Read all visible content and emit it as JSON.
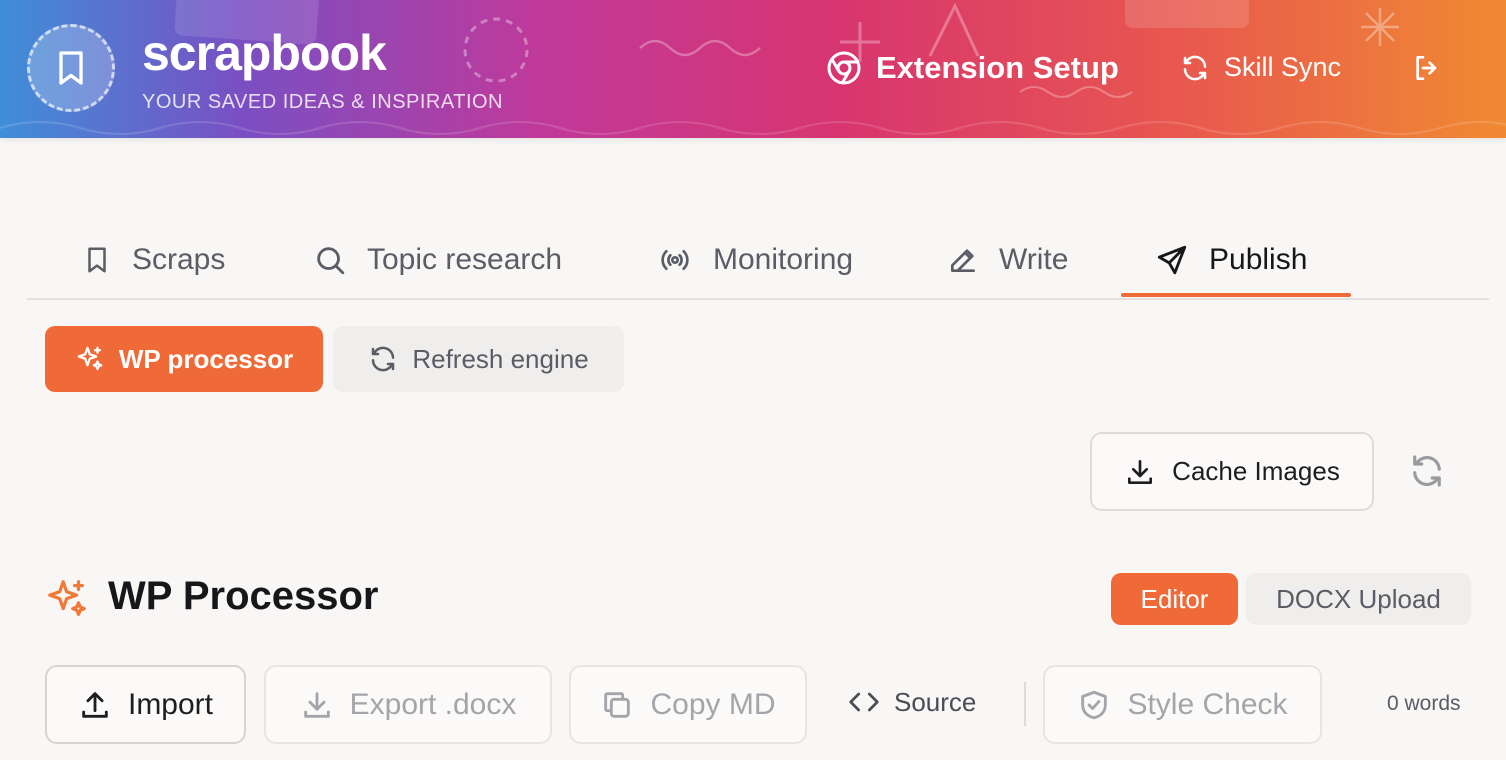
{
  "header": {
    "brand": "scrapbook",
    "tagline": "YOUR SAVED IDEAS & INSPIRATION",
    "logo_icon": "bookmark-icon",
    "extension_setup_label": "Extension Setup",
    "extension_icon": "chrome-icon",
    "skill_sync_label": "Skill Sync",
    "skill_sync_icon": "refresh-icon",
    "logout_icon": "logout-icon"
  },
  "tabs": [
    {
      "label": "Scraps",
      "icon": "bookmark-icon",
      "active": false
    },
    {
      "label": "Topic research",
      "icon": "search-icon",
      "active": false
    },
    {
      "label": "Monitoring",
      "icon": "radio-icon",
      "active": false
    },
    {
      "label": "Write",
      "icon": "pencil-icon",
      "active": false
    },
    {
      "label": "Publish",
      "icon": "send-icon",
      "active": true
    }
  ],
  "subnav": {
    "wp_processor_label": "WP processor",
    "refresh_engine_label": "Refresh engine"
  },
  "actions": {
    "cache_images_label": "Cache Images"
  },
  "section": {
    "title": "WP Processor",
    "mode_editor": "Editor",
    "mode_docx": "DOCX Upload",
    "active_mode": "Editor"
  },
  "toolbar": {
    "import_label": "Import",
    "export_label": "Export .docx",
    "copy_label": "Copy MD",
    "source_label": "Source",
    "style_check_label": "Style Check",
    "word_count": "0 words"
  },
  "colors": {
    "accent": "#ef6a37",
    "header_gradient_start": "#3f8fd8",
    "header_gradient_end": "#f08a32",
    "background": "#f8f7f5"
  }
}
